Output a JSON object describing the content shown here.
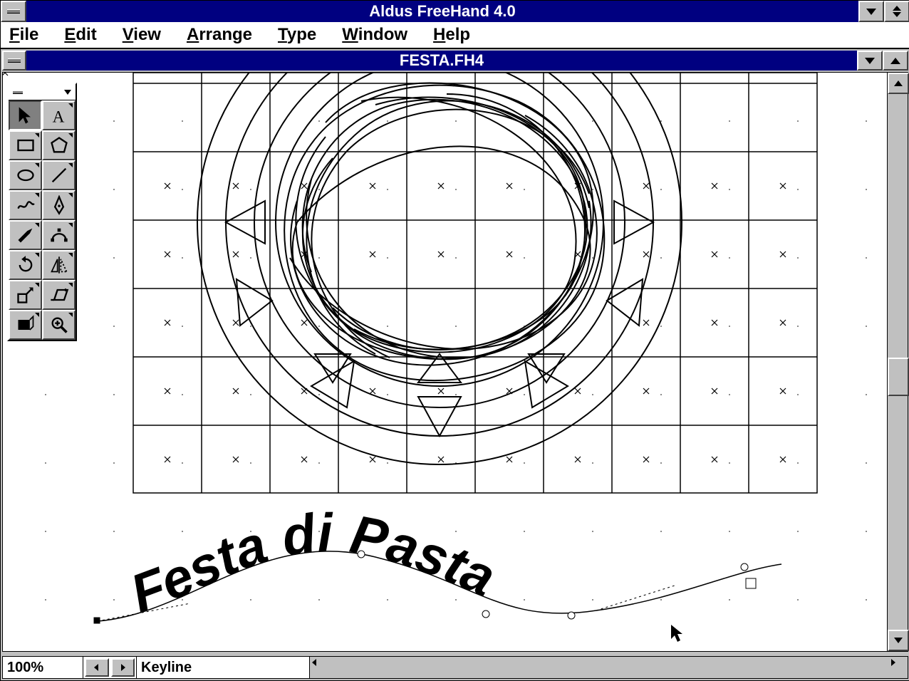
{
  "app": {
    "title": "Aldus FreeHand 4.0"
  },
  "menubar": {
    "items": [
      {
        "hot": "F",
        "rest": "ile"
      },
      {
        "hot": "E",
        "rest": "dit"
      },
      {
        "hot": "V",
        "rest": "iew"
      },
      {
        "hot": "A",
        "rest": "rrange"
      },
      {
        "hot": "T",
        "rest": "ype"
      },
      {
        "hot": "W",
        "rest": "indow"
      },
      {
        "hot": "H",
        "rest": "elp"
      }
    ]
  },
  "document": {
    "title": "FESTA.FH4"
  },
  "artwork": {
    "text_on_path": "Festa di Pasta"
  },
  "toolbox": {
    "tools": [
      "pointer-tool",
      "text-tool",
      "rectangle-tool",
      "polygon-tool",
      "ellipse-tool",
      "line-tool",
      "freehand-tool",
      "pen-tool",
      "knife-tool",
      "bezigon-tool",
      "rotate-tool",
      "reflect-tool",
      "scale-tool",
      "skew-tool",
      "trace-tool",
      "zoom-tool"
    ]
  },
  "status": {
    "zoom": "100%",
    "view_mode": "Keyline"
  }
}
